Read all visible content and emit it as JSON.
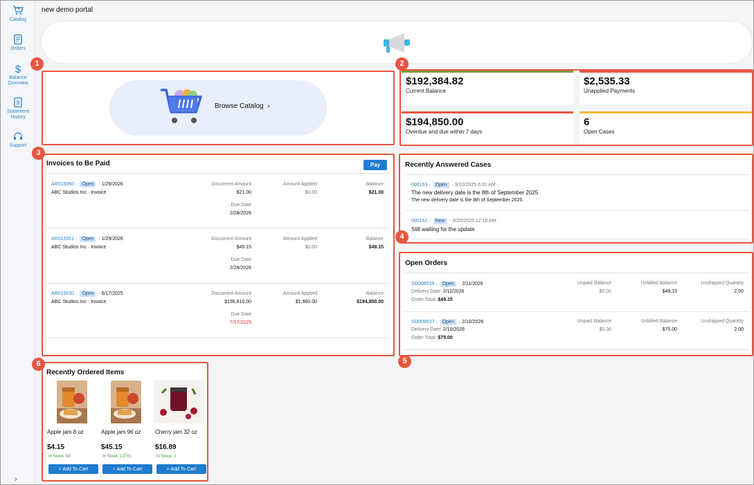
{
  "sidebar": {
    "items": [
      {
        "label": "Catalog",
        "icon": "cart-icon"
      },
      {
        "label": "Orders",
        "icon": "orders-icon"
      },
      {
        "label": "Balance Overview",
        "icon": "dollar-icon"
      },
      {
        "label": "Statement History",
        "icon": "statement-icon"
      },
      {
        "label": "Support",
        "icon": "headset-icon"
      }
    ],
    "expand_glyph": "›"
  },
  "header": {
    "title": "new demo portal"
  },
  "markers": [
    "1",
    "2",
    "3",
    "4",
    "5",
    "6"
  ],
  "catalog": {
    "browse_label": "Browse Catalog",
    "chevron": "›"
  },
  "kpis": [
    {
      "value": "$192,384.82",
      "label": "Current Balance",
      "color": "#7a9a3c"
    },
    {
      "value": "$2,535.33",
      "label": "Unapplied Payments",
      "color": "#e8553f"
    },
    {
      "value": "$194,850.00",
      "label": "Overdue and due within 7 days",
      "color": "#e8553f"
    },
    {
      "value": "6",
      "label": "Open Cases",
      "color": "#f0b93a"
    }
  ],
  "invoices": {
    "title": "Invoices to Be Paid",
    "pay_label": "Pay",
    "col_doc": "Document Amount",
    "col_applied": "Amount Applied",
    "col_balance": "Balance",
    "col_due": "Due Date",
    "rows": [
      {
        "id": "AR015060",
        "status": "Open",
        "date": "1/29/2026",
        "customer": "ABC Studios Inc · Invoice",
        "doc_amount": "$21.00",
        "applied": "$0.00",
        "balance": "$21.00",
        "due": "2/28/2026",
        "overdue": false
      },
      {
        "id": "AR015061",
        "status": "Open",
        "date": "1/29/2026",
        "customer": "ABC Studios Inc · Invoice",
        "doc_amount": "$49.15",
        "applied": "$0.00",
        "balance": "$49.15",
        "due": "2/28/2026",
        "overdue": false
      },
      {
        "id": "AR015030",
        "status": "Open",
        "date": "6/17/2025",
        "customer": "ABC Studios Inc · Invoice",
        "doc_amount": "$196,810.00",
        "applied": "$1,960.00",
        "balance": "$194,850.00",
        "due": "7/17/2025",
        "overdue": true
      }
    ]
  },
  "cases": {
    "title": "Recently Answered Cases",
    "rows": [
      {
        "id": "000163",
        "status": "Open",
        "meta": "9/10/2025 6:31 AM ·",
        "subject": "The new delivery date is the 8th of September 2025",
        "body": "The new delivery date is the 8th of September 2025."
      },
      {
        "id": "000162",
        "status": "New",
        "meta": "8/20/2025 12:18 AM ·",
        "subject": "Still waiting for the update",
        "body": ""
      }
    ]
  },
  "orders": {
    "title": "Open Orders",
    "col_unpaid": "Unpaid Balance",
    "col_unbilled": "Unbilled Balance",
    "col_unshipped": "Unshipped Quantity",
    "delivery_label": "Delivery Date:",
    "total_label": "Order Total:",
    "rows": [
      {
        "id": "SO008539",
        "status": "Open",
        "date": "2/11/2026",
        "delivery": "2/11/2026",
        "total": "$49.15",
        "unpaid": "$0.00",
        "unbilled": "$49.15",
        "unshipped": "2.00"
      },
      {
        "id": "SO008537",
        "status": "Open",
        "date": "2/10/2026",
        "delivery": "2/10/2026",
        "total": "$75.00",
        "unpaid": "$0.00",
        "unbilled": "$75.00",
        "unshipped": "2.00"
      }
    ]
  },
  "recent_items": {
    "title": "Recently Ordered Items",
    "add_label": "+ Add To Cart",
    "items": [
      {
        "name": "Apple jam 8 oz",
        "price": "$4.15",
        "stock": "In Stock: 59"
      },
      {
        "name": "Apple jam 96 oz",
        "price": "$45.15",
        "stock": "In Stock: 13731"
      },
      {
        "name": "Cherry jam 32 oz",
        "price": "$16.89",
        "stock": "In Stock: 2"
      }
    ]
  }
}
